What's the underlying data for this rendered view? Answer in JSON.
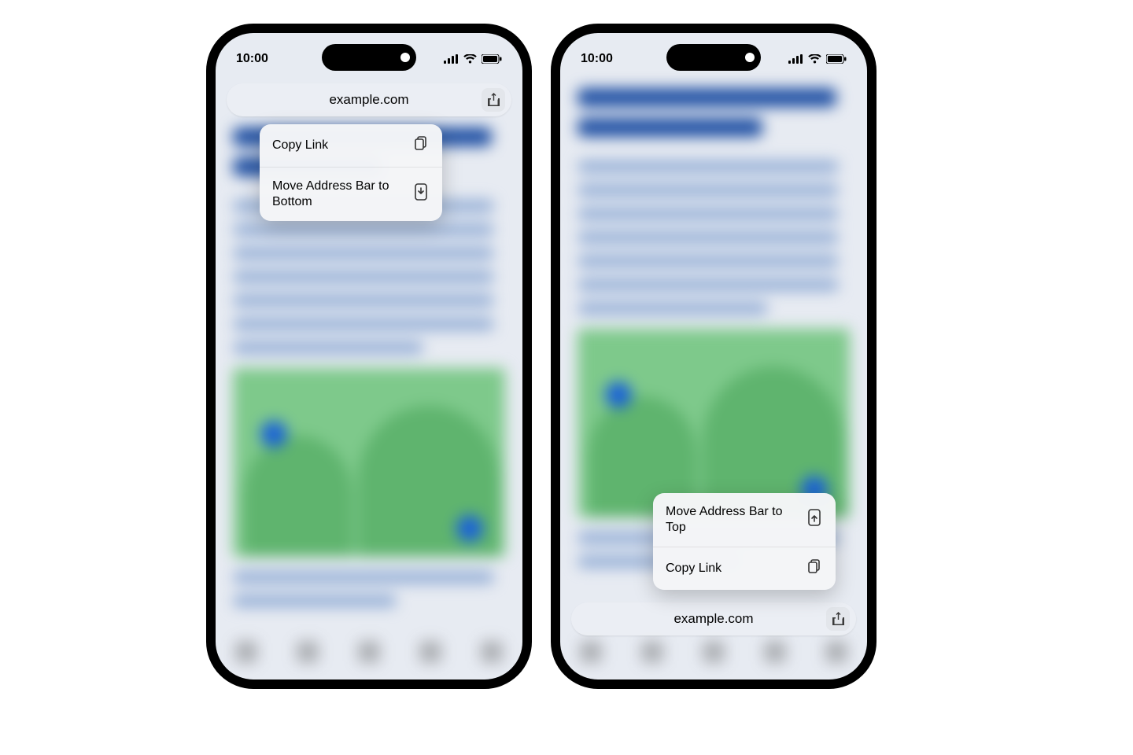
{
  "status": {
    "time": "10:00"
  },
  "phone1": {
    "url": "example.com",
    "menu": [
      {
        "label": "Copy Link",
        "icon": "copy"
      },
      {
        "label": "Move Address Bar to Bottom",
        "icon": "dock-bottom"
      }
    ]
  },
  "phone2": {
    "url": "example.com",
    "menu": [
      {
        "label": "Move Address Bar to Top",
        "icon": "dock-top"
      },
      {
        "label": "Copy Link",
        "icon": "copy"
      }
    ]
  }
}
